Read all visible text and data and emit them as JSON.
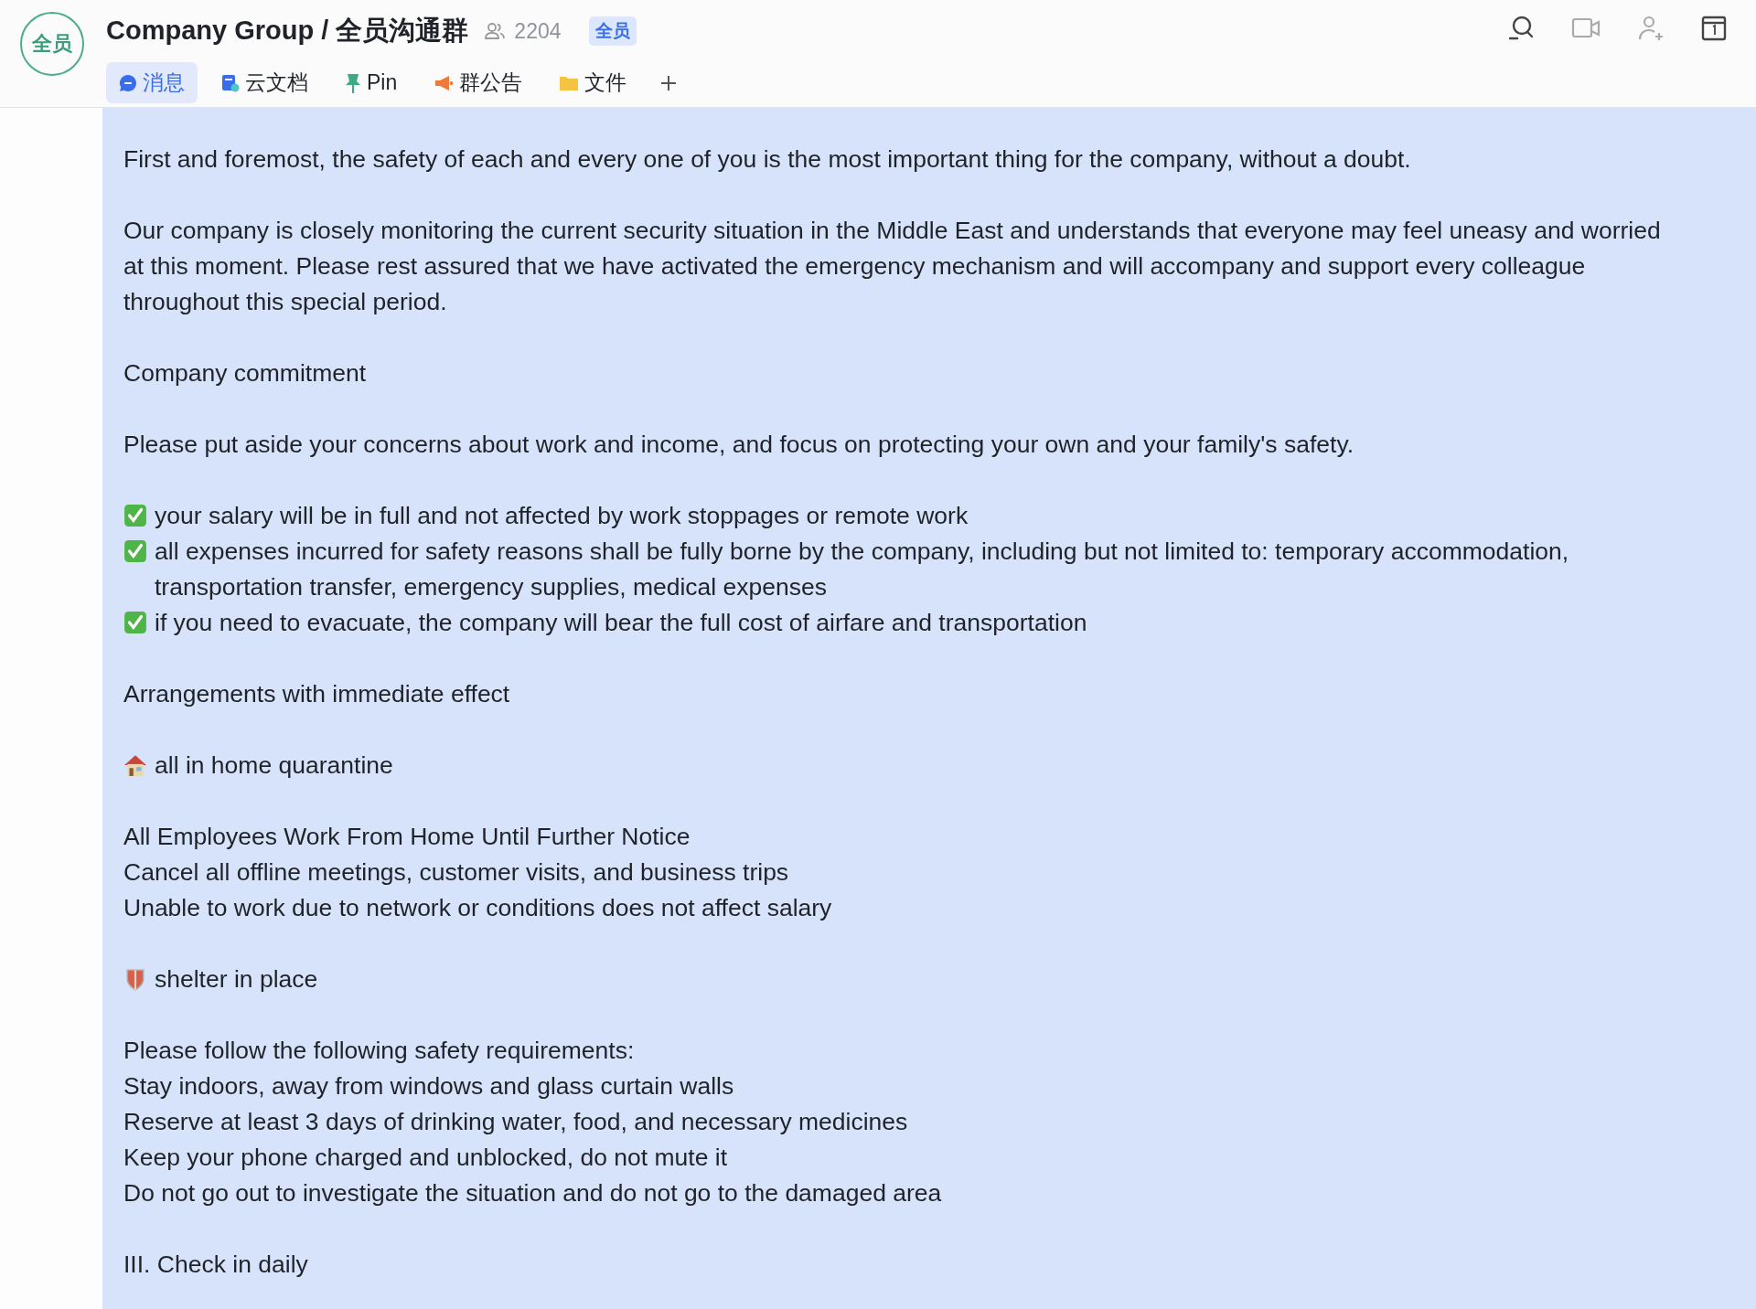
{
  "header": {
    "avatar": "全员",
    "title": "Company Group / 全员沟通群",
    "member_count": "2204",
    "badge": "全员"
  },
  "tabs": [
    {
      "label": "消息",
      "kind": "chat",
      "selected": true
    },
    {
      "label": "云文档",
      "kind": "doc",
      "selected": false
    },
    {
      "label": "Pin",
      "kind": "pin",
      "selected": false
    },
    {
      "label": "群公告",
      "kind": "announce",
      "selected": false
    },
    {
      "label": "文件",
      "kind": "folder",
      "selected": false
    }
  ],
  "message": {
    "paragraphs": [
      [
        {
          "kind": "text",
          "text": "First and foremost, the safety of each and every one of you is the most important thing for the company, without a doubt."
        }
      ],
      [
        {
          "kind": "text",
          "text": "Our company is closely monitoring the current security situation in the Middle East and understands that everyone may feel uneasy and worried at this moment. Please rest assured that we have activated the emergency mechanism and will accompany and support every colleague throughout this special period."
        }
      ],
      [
        {
          "kind": "text",
          "text": "Company commitment"
        }
      ],
      [
        {
          "kind": "text",
          "text": "Please put aside your concerns about work and income, and focus on protecting your own and your family's safety."
        }
      ],
      [
        {
          "kind": "check",
          "text": "your salary will be in full and not affected by work stoppages or remote work"
        },
        {
          "kind": "check",
          "text": "all expenses incurred for safety reasons shall be fully borne by the company, including but not limited to: temporary accommodation, transportation transfer, emergency supplies, medical expenses"
        },
        {
          "kind": "check",
          "text": "if you need to evacuate, the company will bear the full cost of airfare and transportation"
        }
      ],
      [
        {
          "kind": "text",
          "text": "Arrangements with immediate effect"
        }
      ],
      [
        {
          "kind": "house",
          "text": "all in home quarantine"
        }
      ],
      [
        {
          "kind": "text",
          "text": "All Employees Work From Home Until Further Notice"
        },
        {
          "kind": "text",
          "text": "Cancel all offline meetings, customer visits, and business trips"
        },
        {
          "kind": "text",
          "text": "Unable to work due to network or conditions does not affect salary"
        }
      ],
      [
        {
          "kind": "shield",
          "text": "shelter in place"
        }
      ],
      [
        {
          "kind": "text",
          "text": "Please follow the following safety requirements:"
        },
        {
          "kind": "text",
          "text": "Stay indoors, away from windows and glass curtain walls"
        },
        {
          "kind": "text",
          "text": "Reserve at least 3 days of drinking water, food, and necessary medicines"
        },
        {
          "kind": "text",
          "text": "Keep your phone charged and unblocked, do not mute it"
        },
        {
          "kind": "text",
          "text": "Do not go out to investigate the situation and do not go to the damaged area"
        }
      ],
      [
        {
          "kind": "text",
          "text": "III. Check in daily"
        }
      ]
    ]
  }
}
